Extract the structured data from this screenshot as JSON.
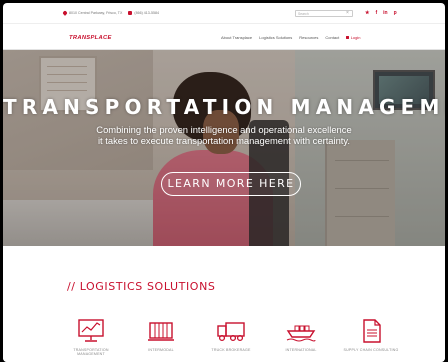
{
  "topbar": {
    "address": "8010 Central Parkway, Frisco, TX",
    "phone": "(866) 413-5584",
    "search_placeholder": "Search",
    "social": [
      "twitter-icon",
      "facebook-icon",
      "linkedin-icon",
      "pinterest-icon"
    ],
    "social_glyphs": [
      "★",
      "f",
      "in",
      "p"
    ]
  },
  "nav": {
    "logo": "TRANSPLACE",
    "items": [
      "About Transplace",
      "Logistics Solutions",
      "Resources",
      "Contact"
    ],
    "login": "Login"
  },
  "hero": {
    "title": "TRANSPORTATION MANAGEMENT",
    "subtitle_line1": "Combining the proven intelligence and operational excellence",
    "subtitle_line2": "it takes to execute transportation management with certainty.",
    "button": "LEARN MORE HERE"
  },
  "section": {
    "title": "// LOGISTICS SOLUTIONS",
    "services": [
      {
        "icon": "monitor-chart-icon",
        "label": "TRANSPORTATION MANAGEMENT"
      },
      {
        "icon": "container-icon",
        "label": "INTERMODAL"
      },
      {
        "icon": "truck-icon",
        "label": "TRUCK BROKERAGE"
      },
      {
        "icon": "ship-icon",
        "label": "INTERNATIONAL"
      },
      {
        "icon": "document-icon",
        "label": "SUPPLY CHAIN CONSULTING"
      }
    ]
  },
  "colors": {
    "brand_red": "#c8102e",
    "nav_text": "#555555",
    "hero_text": "#ffffff"
  }
}
